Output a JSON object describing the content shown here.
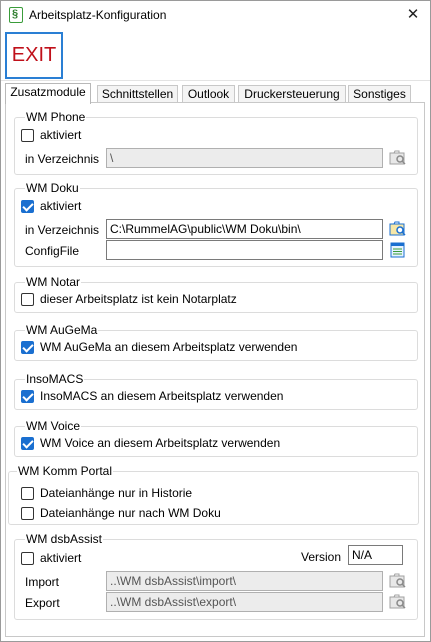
{
  "window": {
    "title": "Arbeitsplatz-Konfiguration",
    "close_glyph": "✕"
  },
  "toolbar": {
    "exit_label": "EXIT"
  },
  "tabs": [
    "Zusatzmodule",
    "Schnittstellen",
    "Outlook",
    "Druckersteuerung",
    "Sonstiges"
  ],
  "phone": {
    "title": "WM Phone",
    "enabled_label": "aktiviert",
    "enabled": false,
    "dir_label": "in Verzeichnis",
    "dir_value": "\\"
  },
  "doku": {
    "title": "WM Doku",
    "enabled_label": "aktiviert",
    "enabled": true,
    "dir_label": "in Verzeichnis",
    "dir_value": "C:\\RummelAG\\public\\WM Doku\\bin\\",
    "config_label": "ConfigFile",
    "config_value": ""
  },
  "notar": {
    "title": "WM Notar",
    "option_label": "dieser Arbeitsplatz ist kein Notarplatz",
    "checked": false
  },
  "augema": {
    "title": "WM AuGeMa",
    "option_label": "WM AuGeMa an diesem Arbeitsplatz verwenden",
    "checked": true
  },
  "insomacs": {
    "title": "InsoMACS",
    "option_label": "InsoMACS an diesem Arbeitsplatz verwenden",
    "checked": true
  },
  "voice": {
    "title": "WM Voice",
    "option_label": "WM Voice an diesem Arbeitsplatz verwenden",
    "checked": true
  },
  "komm": {
    "title": "WM Komm Portal",
    "option1_label": "Dateianhänge nur in Historie",
    "option1_checked": false,
    "option2_label": "Dateianhänge nur nach WM Doku",
    "option2_checked": false
  },
  "dsb": {
    "title": "WM dsbAssist",
    "enabled_label": "aktiviert",
    "enabled": false,
    "version_label": "Version",
    "version_value": "N/A",
    "import_label": "Import",
    "import_value": "..\\WM dsbAssist\\import\\",
    "export_label": "Export",
    "export_value": "..\\WM dsbAssist\\export\\"
  },
  "colors": {
    "accent": "#1a6fd0",
    "exit_text": "#c0101a",
    "exit_border": "#2a7fd4"
  }
}
